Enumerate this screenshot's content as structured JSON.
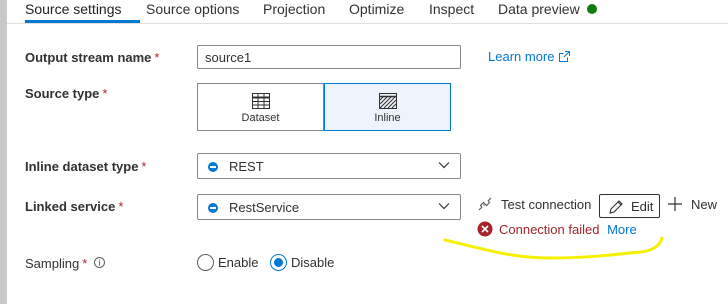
{
  "tabs": [
    {
      "label": "Source settings",
      "active": true
    },
    {
      "label": "Source options"
    },
    {
      "label": "Projection"
    },
    {
      "label": "Optimize"
    },
    {
      "label": "Inspect"
    },
    {
      "label": "Data preview"
    }
  ],
  "form": {
    "output_stream": {
      "label": "Output stream name",
      "required": "*",
      "value": "source1",
      "learn_more": "Learn more"
    },
    "source_type": {
      "label": "Source type",
      "required": "*",
      "options": [
        "Dataset",
        "Inline"
      ],
      "selected": "Inline"
    },
    "inline_dataset_type": {
      "label": "Inline dataset type",
      "required": "*",
      "value": "REST"
    },
    "linked_service": {
      "label": "Linked service",
      "required": "*",
      "value": "RestService"
    },
    "sampling": {
      "label": "Sampling",
      "required": "*",
      "options": [
        "Enable",
        "Disable"
      ],
      "selected": "Disable"
    }
  },
  "actions": {
    "test_connection": "Test connection",
    "edit": "Edit",
    "new": "New"
  },
  "error": {
    "message": "Connection failed",
    "more": "More"
  },
  "colors": {
    "accent": "#0078d4",
    "error": "#a4262c",
    "status_ok": "#107c10",
    "annotation": "#f5f000"
  }
}
